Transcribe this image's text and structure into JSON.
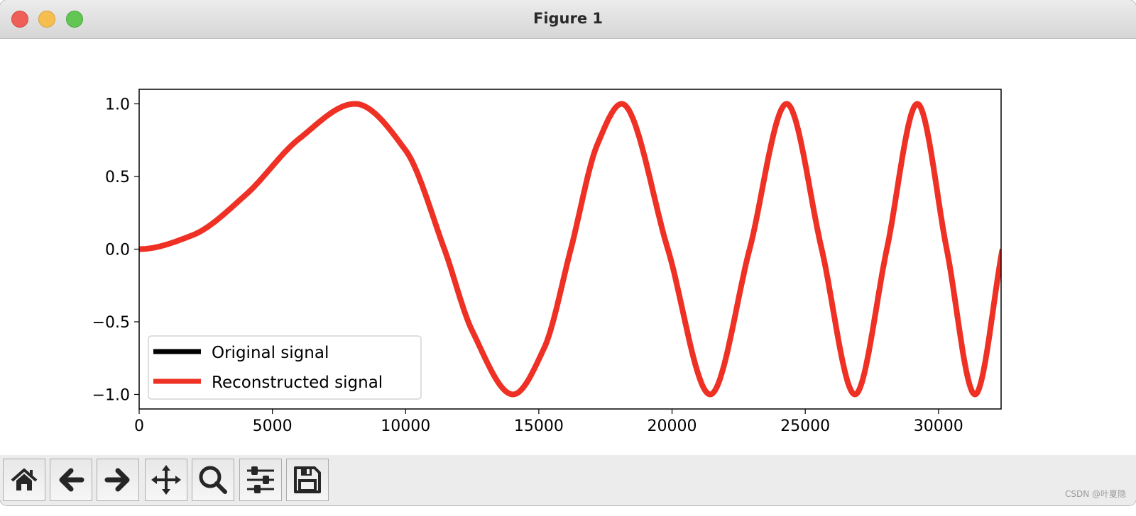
{
  "window": {
    "title": "Figure 1",
    "traffic_lights": {
      "close": "#ee5f57",
      "minimize": "#f6be4f",
      "zoom": "#62c554"
    }
  },
  "toolbar": {
    "buttons": [
      {
        "name": "home",
        "icon": "home-icon"
      },
      {
        "name": "back",
        "icon": "arrow-left-icon"
      },
      {
        "name": "forward",
        "icon": "arrow-right-icon"
      },
      {
        "name": "pan",
        "icon": "move-icon"
      },
      {
        "name": "zoom",
        "icon": "magnifier-icon"
      },
      {
        "name": "configure-subplots",
        "icon": "sliders-icon"
      },
      {
        "name": "save",
        "icon": "floppy-disk-icon"
      }
    ]
  },
  "watermark": "CSDN @叶夏隐",
  "chart_data": {
    "type": "line",
    "title": "",
    "xlabel": "",
    "ylabel": "",
    "xlim": [
      0,
      32350
    ],
    "ylim": [
      -1.1,
      1.1
    ],
    "xticks": [
      0,
      5000,
      10000,
      15000,
      20000,
      25000,
      30000
    ],
    "xtick_labels": [
      "0",
      "5000",
      "10000",
      "15000",
      "20000",
      "25000",
      "30000"
    ],
    "yticks": [
      1.0,
      0.5,
      0.0,
      -0.5,
      -1.0
    ],
    "ytick_labels": [
      "1.0",
      "0.5",
      "0.0",
      "−0.5",
      "−1.0"
    ],
    "grid": false,
    "legend": {
      "placement": "lower-left",
      "entries": [
        "Original signal",
        "Reconstructed signal"
      ]
    },
    "series": [
      {
        "name": "Original signal",
        "color": "#000000",
        "x": [
          0,
          2000,
          4000,
          6000,
          8100,
          10000,
          11455,
          12500,
          14030,
          15200,
          16201,
          17200,
          18113,
          19842,
          21432,
          22911,
          24300,
          25616,
          26866,
          28061,
          29206,
          30309,
          31372,
          32400
        ],
        "y": [
          0,
          0.096,
          0.374,
          0.759,
          1,
          0.68,
          0,
          -0.562,
          -1,
          -0.681,
          0,
          0.722,
          1,
          0,
          -1,
          0,
          1,
          0,
          -1,
          0,
          1,
          0,
          -1,
          0
        ]
      },
      {
        "name": "Reconstructed signal",
        "color": "#ee3124",
        "x": [
          0,
          2000,
          4000,
          6000,
          8100,
          10000,
          11455,
          12500,
          14030,
          15200,
          16201,
          17200,
          18113,
          19842,
          21432,
          22911,
          24300,
          25616,
          26866,
          28061,
          29206,
          30309,
          31372,
          32400
        ],
        "y": [
          0,
          0.096,
          0.374,
          0.759,
          1,
          0.68,
          0,
          -0.562,
          -1,
          -0.681,
          0,
          0.722,
          1,
          0,
          -1,
          0,
          1,
          0,
          -1,
          0,
          1,
          0,
          -1,
          0
        ]
      }
    ]
  }
}
